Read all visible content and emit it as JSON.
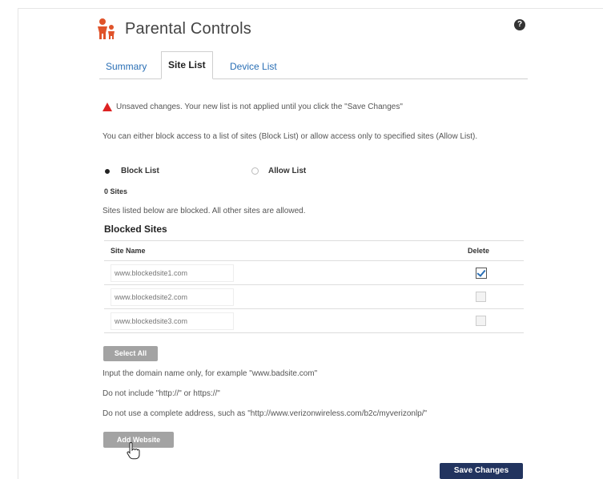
{
  "header": {
    "title": "Parental Controls",
    "help_icon": "?"
  },
  "tabs": [
    {
      "label": "Summary",
      "active": false
    },
    {
      "label": "Site List",
      "active": true
    },
    {
      "label": "Device List",
      "active": false
    }
  ],
  "warning": "Unsaved changes. Your new list is not applied until you click the \"Save Changes\"",
  "intro": "You can either block access to a list of sites (Block List) or allow access only to specified sites (Allow List).",
  "mode": {
    "block_label": "Block List",
    "allow_label": "Allow List",
    "selected": "Block List"
  },
  "sites_count": "0 Sites",
  "sites_note": "Sites listed below are blocked. All other sites are allowed.",
  "blocked_sites": {
    "title": "Blocked Sites",
    "col_site": "Site Name",
    "col_delete": "Delete",
    "rows": [
      {
        "site": "www.blockedsite1.com",
        "delete_checked": true
      },
      {
        "site": "www.blockedsite2.com",
        "delete_checked": false
      },
      {
        "site": "www.blockedsite3.com",
        "delete_checked": false
      }
    ]
  },
  "select_all_label": "Select All",
  "hints": [
    "Input the domain name only, for example \"www.badsite.com\"",
    "Do not include \"http://\" or https://\"",
    "Do not use a complete address, such as \"http://www.verizonwireless.com/b2c/myverizonlp/\""
  ],
  "add_website_label": "Add Website",
  "save_label": "Save Changes",
  "colors": {
    "link": "#2a6fb5",
    "save_button": "#22345f",
    "warning": "#dd2222",
    "logo": "#e0532a"
  }
}
